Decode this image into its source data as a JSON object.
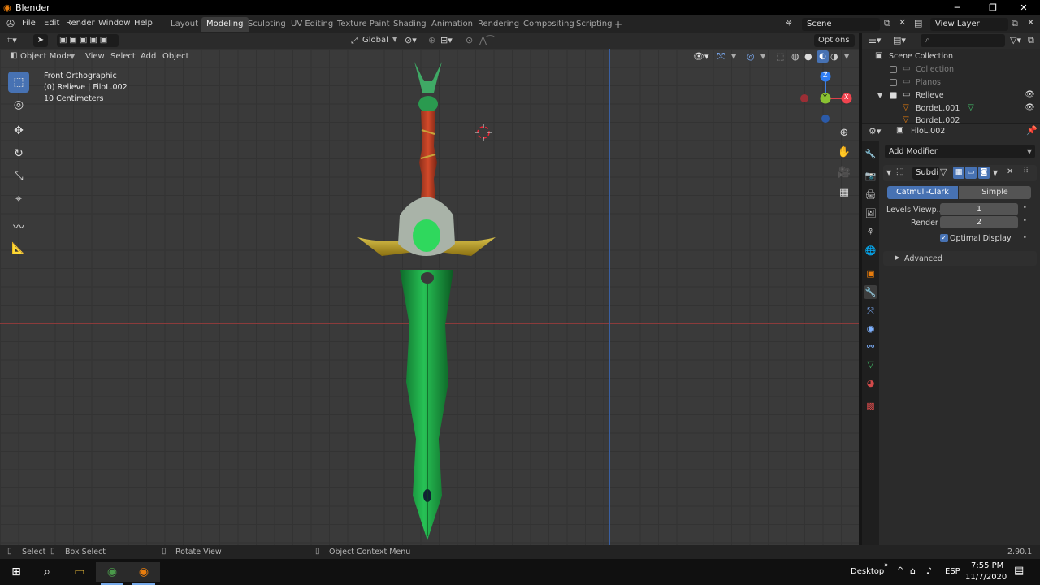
{
  "window": {
    "title": "Blender",
    "min": "─",
    "max": "❐",
    "close": "✕"
  },
  "menu": [
    "File",
    "Edit",
    "Render",
    "Window",
    "Help"
  ],
  "workspaces": [
    "Layout",
    "Modeling",
    "Sculpting",
    "UV Editing",
    "Texture Paint",
    "Shading",
    "Animation",
    "Rendering",
    "Compositing",
    "Scripting"
  ],
  "active_workspace": "Modeling",
  "scene": {
    "name": "Scene",
    "view_layer": "View Layer"
  },
  "tool_header": {
    "orientation": "Global",
    "options": "Options"
  },
  "viewport_header": {
    "mode": "Object Mode",
    "menus": [
      "View",
      "Select",
      "Add",
      "Object"
    ]
  },
  "viewport_info": {
    "view": "Front Orthographic",
    "object": "(0) Relieve | FiloL.002",
    "scale": "10 Centimeters"
  },
  "gizmo": {
    "z": "Z",
    "y": "Y",
    "x": "X"
  },
  "outliner": {
    "root": "Scene Collection",
    "items": [
      {
        "label": "Collection",
        "checked": false
      },
      {
        "label": "Planos",
        "checked": false
      },
      {
        "label": "Relieve",
        "checked": true
      },
      {
        "label": "BordeL.001"
      },
      {
        "label": "BordeL.002"
      }
    ]
  },
  "properties": {
    "object_name": "FiloL.002",
    "add_modifier": "Add Modifier",
    "modifier_name": "Subdi",
    "algorithm": {
      "options": [
        "Catmull-Clark",
        "Simple"
      ],
      "selected": "Catmull-Clark"
    },
    "levels_viewport_label": "Levels Viewp...",
    "levels_viewport_value": "1",
    "render_label": "Render",
    "render_value": "2",
    "optimal_display": "Optimal Display",
    "advanced": "Advanced"
  },
  "status_bar": {
    "select": "Select",
    "box_select": "Box Select",
    "rotate": "Rotate View",
    "context": "Object Context Menu",
    "version": "2.90.1"
  },
  "taskbar": {
    "desktop": "Desktop",
    "lang": "ESP",
    "time": "7:55 PM",
    "date": "11/7/2020"
  }
}
